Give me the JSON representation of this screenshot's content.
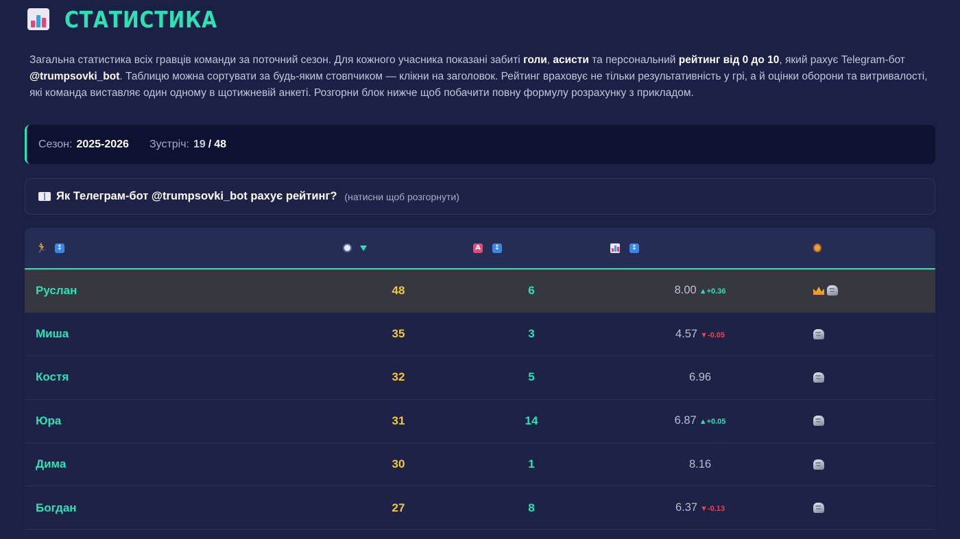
{
  "header": {
    "title": "СТАТИСТИКА",
    "icon": "bar-chart-icon"
  },
  "description": {
    "p1": "Загальна статистика всіх гравців команди за поточний сезон. Для кожного учасника показані забиті ",
    "b1": "голи",
    "p2": ", ",
    "b2": "асисти",
    "p3": " та персональний ",
    "b3": "рейтинг від 0 до 10",
    "p4": ", який рахує Telegram-бот ",
    "b4": "@trumpsovki_bot",
    "p5": ". Таблицю можна сортувати за будь-яким стовпчиком — клікни на заголовок. Рейтинг враховує не тільки результативність у грі, а й оцінки оборони та витривалості, які команда виставляє один одному в щотижневій анкеті. Розгорни блок нижче щоб побачити повну формулу розрахунку з прикладом."
  },
  "season": {
    "season_label": "Сезон:",
    "season_value": "2025-2026",
    "matches_label": "Зустріч:",
    "matches_current": "19",
    "matches_sep": "/",
    "matches_total": "48"
  },
  "expand": {
    "title": "Як Телеграм-бот @trumpsovki_bot рахує рейтинг?",
    "hint": "(натисни щоб розгорнути)"
  },
  "table": {
    "columns": [
      {
        "key": "name",
        "icon": "runner-icon",
        "sort": "sort-both-icon"
      },
      {
        "key": "goals",
        "icon": "soccer-ball-icon",
        "sort": "sort-desc-icon"
      },
      {
        "key": "assists",
        "icon": "letter-a-icon",
        "sort": "sort-both-icon"
      },
      {
        "key": "rating",
        "icon": "bar-chart-icon",
        "sort": "sort-both-icon"
      },
      {
        "key": "badges",
        "icon": "medal-icon"
      }
    ],
    "rows": [
      {
        "name": "Руслан",
        "goals": "48",
        "assists": "6",
        "rating": "8.00",
        "delta": "▲+0.36",
        "delta_dir": "up",
        "badges": [
          "crown-icon",
          "stone-icon"
        ]
      },
      {
        "name": "Миша",
        "goals": "35",
        "assists": "3",
        "rating": "4.57",
        "delta": "▼-0.05",
        "delta_dir": "down",
        "badges": [
          "stone-icon"
        ]
      },
      {
        "name": "Костя",
        "goals": "32",
        "assists": "5",
        "rating": "6.96",
        "delta": "",
        "delta_dir": "",
        "badges": [
          "stone-icon"
        ]
      },
      {
        "name": "Юра",
        "goals": "31",
        "assists": "14",
        "rating": "6.87",
        "delta": "▲+0.05",
        "delta_dir": "up",
        "badges": [
          "stone-icon"
        ]
      },
      {
        "name": "Дима",
        "goals": "30",
        "assists": "1",
        "rating": "8.16",
        "delta": "",
        "delta_dir": "",
        "badges": [
          "stone-icon"
        ]
      },
      {
        "name": "Богдан",
        "goals": "27",
        "assists": "8",
        "rating": "6.37",
        "delta": "▼-0.13",
        "delta_dir": "down",
        "badges": [
          "stone-icon"
        ]
      }
    ]
  },
  "colors": {
    "background": "#1b2145",
    "accent": "#2ee0b6",
    "goals": "#f2c93c",
    "up": "#2ee0b6",
    "down": "#f0414e"
  }
}
